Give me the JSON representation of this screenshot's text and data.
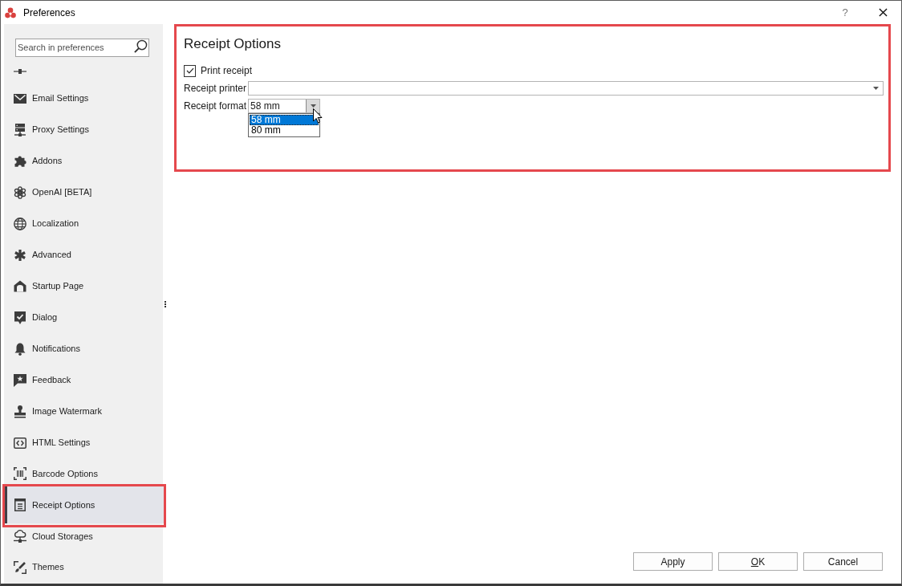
{
  "window": {
    "title": "Preferences",
    "help": "?"
  },
  "sidebar": {
    "search": {
      "placeholder": "Search in preferences"
    },
    "items": [
      {
        "label": "Email Settings",
        "selected": false
      },
      {
        "label": "Proxy Settings",
        "selected": false
      },
      {
        "label": "Addons",
        "selected": false
      },
      {
        "label": "OpenAI [BETA]",
        "selected": false
      },
      {
        "label": "Localization",
        "selected": false
      },
      {
        "label": "Advanced",
        "selected": false
      },
      {
        "label": "Startup Page",
        "selected": false
      },
      {
        "label": "Dialog",
        "selected": false
      },
      {
        "label": "Notifications",
        "selected": false
      },
      {
        "label": "Feedback",
        "selected": false
      },
      {
        "label": "Image Watermark",
        "selected": false
      },
      {
        "label": "HTML Settings",
        "selected": false
      },
      {
        "label": "Barcode Options",
        "selected": false
      },
      {
        "label": "Receipt Options",
        "selected": true
      },
      {
        "label": "Cloud Storages",
        "selected": false
      },
      {
        "label": "Themes",
        "selected": false
      }
    ]
  },
  "panel": {
    "title": "Receipt Options",
    "print_receipt": {
      "label": "Print receipt",
      "checked": true
    },
    "fields": [
      {
        "label": "Receipt printer",
        "expanded": false
      },
      {
        "label": "Receipt format",
        "value": "58 mm",
        "expanded": true,
        "options": [
          {
            "label": "58 mm",
            "selected": true
          },
          {
            "label": "80 mm",
            "selected": false
          }
        ]
      }
    ]
  },
  "buttons": [
    {
      "label": "Apply",
      "mnemonic": false
    },
    {
      "label": "OK",
      "mnemonic": true
    },
    {
      "label": "Cancel",
      "mnemonic": false
    }
  ]
}
